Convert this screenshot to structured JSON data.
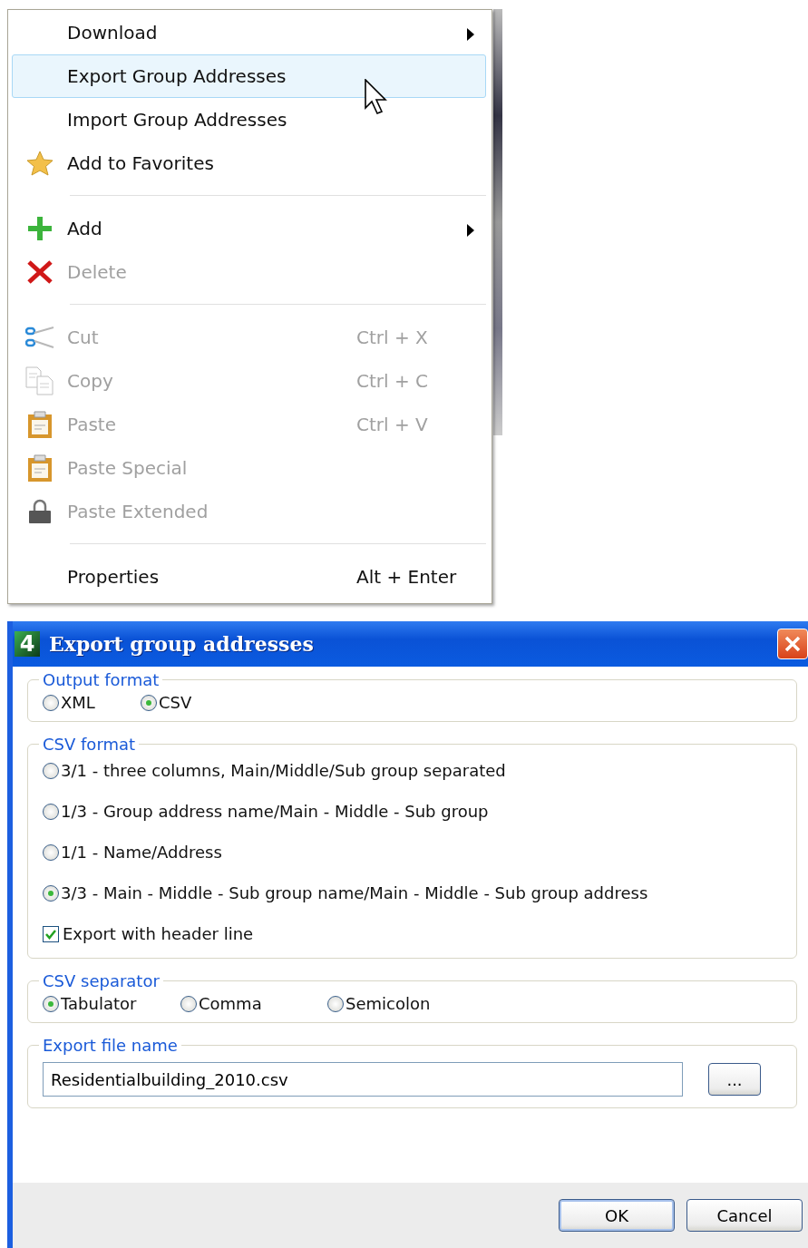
{
  "context_menu": {
    "groups": [
      [
        {
          "label": "Download",
          "submenu": true,
          "disabled": false,
          "selected": false
        },
        {
          "label": "Export Group Addresses",
          "submenu": false,
          "disabled": false,
          "selected": true
        },
        {
          "label": "Import Group Addresses",
          "submenu": false,
          "disabled": false,
          "selected": false
        },
        {
          "label": "Add to Favorites",
          "submenu": false,
          "disabled": false,
          "selected": false
        }
      ],
      [
        {
          "label": "Add",
          "submenu": true,
          "disabled": false,
          "selected": false
        },
        {
          "label": "Delete",
          "submenu": false,
          "disabled": true,
          "selected": false
        }
      ],
      [
        {
          "label": "Cut",
          "shortcut": "Ctrl + X",
          "submenu": false,
          "disabled": true,
          "selected": false
        },
        {
          "label": "Copy",
          "shortcut": "Ctrl + C",
          "submenu": false,
          "disabled": true,
          "selected": false
        },
        {
          "label": "Paste",
          "shortcut": "Ctrl + V",
          "submenu": false,
          "disabled": true,
          "selected": false
        },
        {
          "label": "Paste Special",
          "submenu": false,
          "disabled": true,
          "selected": false
        },
        {
          "label": "Paste Extended",
          "submenu": false,
          "disabled": true,
          "selected": false
        }
      ],
      [
        {
          "label": "Properties",
          "shortcut": "Alt + Enter",
          "submenu": false,
          "disabled": false,
          "selected": false
        }
      ]
    ]
  },
  "dialog": {
    "logo": "4",
    "title": "Export group addresses",
    "output_format": {
      "legend": "Output format",
      "options": [
        {
          "label": "XML",
          "selected": false
        },
        {
          "label": "CSV",
          "selected": true
        }
      ]
    },
    "csv_format": {
      "legend": "CSV format",
      "options": [
        {
          "label": "3/1 - three columns, Main/Middle/Sub group separated",
          "selected": false
        },
        {
          "label": "1/3 - Group address name/Main - Middle - Sub group",
          "selected": false
        },
        {
          "label": "1/1 - Name/Address",
          "selected": false
        },
        {
          "label": "3/3 - Main - Middle - Sub group name/Main - Middle - Sub group address",
          "selected": true
        }
      ],
      "header_line": {
        "label": "Export with header line",
        "checked": true
      }
    },
    "csv_separator": {
      "legend": "CSV separator",
      "options": [
        {
          "label": "Tabulator",
          "selected": true
        },
        {
          "label": "Comma",
          "selected": false
        },
        {
          "label": "Semicolon",
          "selected": false
        }
      ]
    },
    "export_file_name": {
      "legend": "Export file name",
      "value": "Residentialbuilding_2010.csv",
      "browse_button": "..."
    },
    "buttons": [
      "OK",
      "Cancel"
    ]
  }
}
